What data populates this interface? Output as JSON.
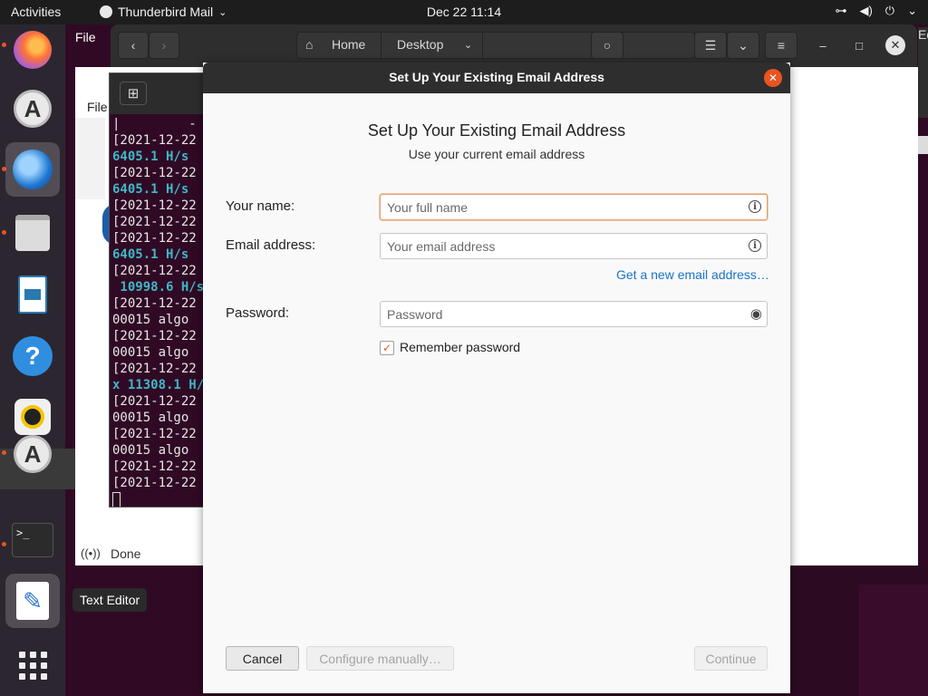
{
  "topbar": {
    "activities": "Activities",
    "app_name": "Thunderbird Mail",
    "app_menu_icon": "chevron-down-icon",
    "clock": "Dec 22  11:14"
  },
  "dock": {
    "tooltip": "Text Editor",
    "items": [
      "Firefox",
      "Ubuntu Software",
      "Thunderbird Mail",
      "Files",
      "LibreOffice Writer",
      "Help",
      "Rhythmbox",
      "Ubuntu Software",
      "Terminal",
      "Text Editor",
      "Show Applications"
    ]
  },
  "files_window": {
    "home_label": "Home",
    "desktop_label": "Desktop",
    "edge_text": "Ed"
  },
  "background_app": {
    "file_menu": "File",
    "file_menu_2": "File",
    "status_text": "Done"
  },
  "terminal": {
    "lines": [
      {
        "text": "|         -",
        "style": "w"
      },
      {
        "text": "[2021-12-22",
        "style": "w"
      },
      {
        "text": "6405.1 H/s",
        "style": "c"
      },
      {
        "text": "[2021-12-22",
        "style": "w"
      },
      {
        "text": "6405.1 H/s",
        "style": "c"
      },
      {
        "text": "[2021-12-22",
        "style": "w"
      },
      {
        "text": "[2021-12-22",
        "style": "w"
      },
      {
        "text": "[2021-12-22",
        "style": "w"
      },
      {
        "text": "6405.1 H/s",
        "style": "c"
      },
      {
        "text": "[2021-12-22",
        "style": "w"
      },
      {
        "text": " 10998.6 H/s",
        "style": "c"
      },
      {
        "text": "[2021-12-22",
        "style": "w"
      },
      {
        "text": "00015 algo",
        "style": "w"
      },
      {
        "text": "[2021-12-22",
        "style": "w"
      },
      {
        "text": "00015 algo",
        "style": "w"
      },
      {
        "text": "[2021-12-22",
        "style": "w"
      },
      {
        "text": "x 11308.1 H/",
        "style": "c"
      },
      {
        "text": "[2021-12-22",
        "style": "w"
      },
      {
        "text": "00015 algo",
        "style": "w"
      },
      {
        "text": "[2021-12-22",
        "style": "w"
      },
      {
        "text": "00015 algo",
        "style": "w"
      },
      {
        "text": "[2021-12-22",
        "style": "w"
      },
      {
        "text": "[2021-12-22",
        "style": "w"
      }
    ]
  },
  "dialog": {
    "window_title": "Set Up Your Existing Email Address",
    "heading": "Set Up Your Existing Email Address",
    "subheading": "Use your current email address",
    "name_label": "Your name:",
    "name_value": "",
    "name_placeholder": "Your full name",
    "email_label": "Email address:",
    "email_value": "",
    "email_placeholder": "Your email address",
    "new_email_link": "Get a new email address…",
    "password_label": "Password:",
    "password_value": "",
    "password_placeholder": "Password",
    "remember_label": "Remember password",
    "remember_checked": true,
    "cancel_label": "Cancel",
    "configure_label": "Configure manually…",
    "continue_label": "Continue"
  },
  "colors": {
    "accent": "#e95420",
    "link": "#1a73c8",
    "terminal_bg": "#300a24",
    "terminal_cyan": "#3fb7c9"
  }
}
